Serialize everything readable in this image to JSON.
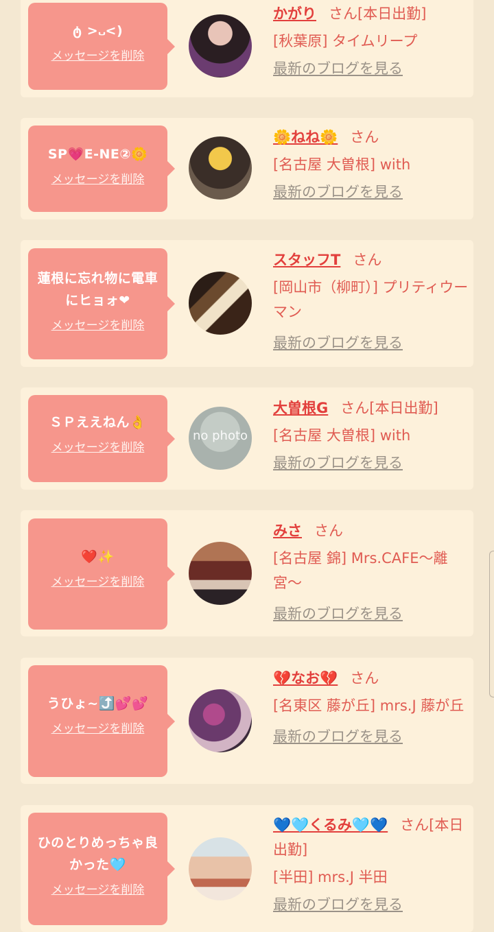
{
  "cards": [
    {
      "message": "ტ >᎑<)",
      "delete_label": "メッセージを削除",
      "name": "かがり",
      "suffix": "さん[本日出勤]",
      "shop": "[秋葉原] タイムリープ",
      "blog_label": "最新のブログを見る",
      "avatar": "avatar-photo"
    },
    {
      "message": "SP💗E-NE②🌼",
      "delete_label": "メッセージを削除",
      "name": "🌼ねね🌼",
      "suffix": "さん",
      "shop": "[名古屋 大曽根] with",
      "blog_label": "最新のブログを見る",
      "avatar": "avatar-photo"
    },
    {
      "message": "蓮根に忘れ物に電車にヒョォ❤",
      "delete_label": "メッセージを削除",
      "name": "スタッフT",
      "suffix": "さん",
      "shop": "[岡山市（柳町）] プリティウーマン",
      "blog_label": "最新のブログを見る",
      "avatar": "avatar-logo"
    },
    {
      "message": "ＳＰええねん👌",
      "delete_label": "メッセージを削除",
      "name": "大曽根G",
      "suffix": "さん[本日出勤]",
      "shop": "[名古屋 大曽根] with",
      "blog_label": "最新のブログを見る",
      "avatar": "no-photo",
      "avatar_text": "no photo"
    },
    {
      "message": "❤️✨",
      "delete_label": "メッセージを削除",
      "name": "みさ",
      "suffix": "さん",
      "shop": "[名古屋 錦] Mrs.CAFE〜離宮〜",
      "blog_label": "最新のブログを見る",
      "avatar": "avatar-photo"
    },
    {
      "message": "うひょ~⤴️💕💕",
      "delete_label": "メッセージを削除",
      "name": "💔なお💔",
      "suffix": "さん",
      "shop": "[名東区 藤が丘] mrs.J 藤が丘",
      "blog_label": "最新のブログを見る",
      "avatar": "avatar-photo"
    },
    {
      "message": "ひのとりめっちゃ良かった🩵",
      "delete_label": "メッセージを削除",
      "name": "💙🩵くるみ🩵💙",
      "suffix": "さん[本日出勤]",
      "shop": "[半田] mrs.J 半田",
      "blog_label": "最新のブログを見る",
      "avatar": "avatar-photo"
    }
  ],
  "colors": {
    "background": "#f4e8d2",
    "card": "#fdf1db",
    "bubble": "#f6968c",
    "name": "#e23f3c",
    "text": "#e05b52",
    "blog": "#9a9288"
  }
}
